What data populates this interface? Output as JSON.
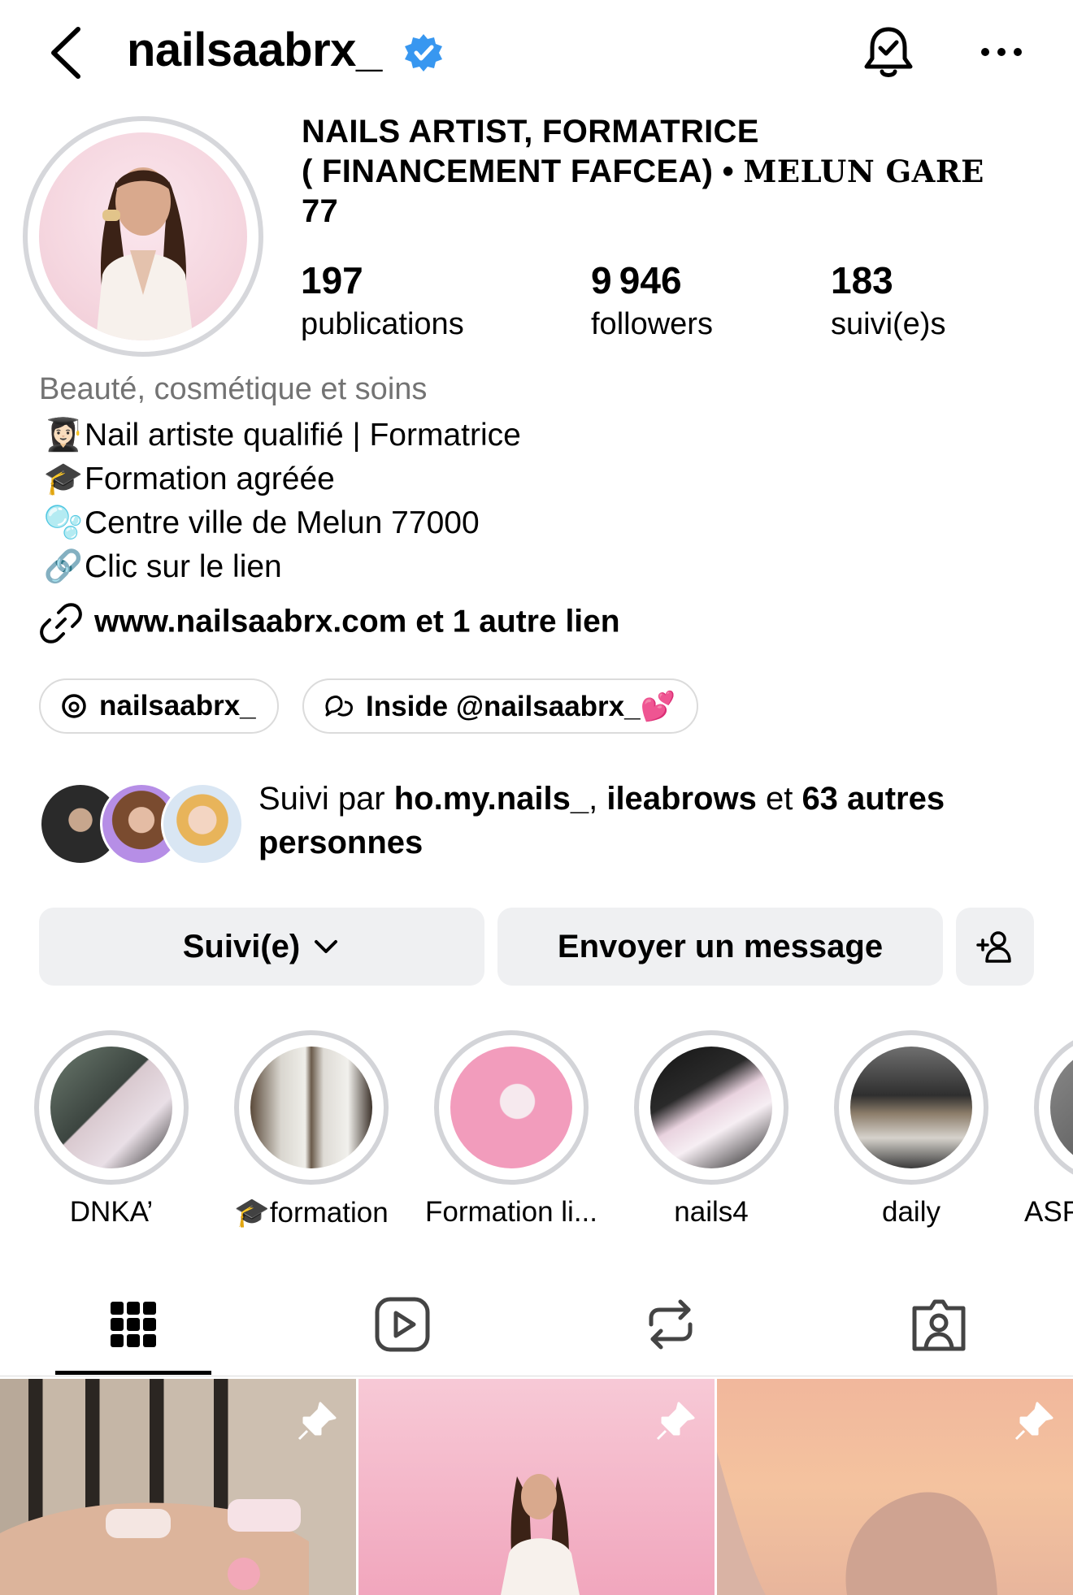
{
  "header": {
    "username": "nailsaabrx_",
    "icons": [
      "back-chevron-icon",
      "verified-badge-icon",
      "notification-bell-icon",
      "more-options-icon"
    ]
  },
  "profile": {
    "name_line1": "NAILS ARTIST, FORMATRICE",
    "name_line2": "( FINANCEMENT FAFCEA) • ",
    "name_line2_styled": "MELUN GARE",
    "name_line3": "77",
    "stats": {
      "posts_count": "197",
      "posts_label": "publications",
      "followers_count": "9 946",
      "followers_label": "followers",
      "following_count": "183",
      "following_label": "suivi(e)s"
    },
    "category": "Beauté, cosmétique et soins",
    "bio": [
      {
        "emoji": "👩🏻‍🎓",
        "text": "Nail artiste qualifié | Formatrice"
      },
      {
        "emoji": "🎓",
        "text": "Formation agréée"
      },
      {
        "emoji": "🫧",
        "text": "Centre ville de Melun 77000"
      },
      {
        "emoji": "🔗",
        "text": "Clic sur le lien"
      }
    ],
    "link_text": "www.nailsaabrx.com et 1 autre lien",
    "pills": [
      {
        "icon": "threads-icon",
        "label": "nailsaabrx_"
      },
      {
        "icon": "channel-icon",
        "label": "Inside @nailsaabrx_💕"
      }
    ],
    "mutual": {
      "prefix": "Suivi par ",
      "user1": "ho.my.nails_",
      "sep": ", ",
      "user2": "ileabrows",
      "mid": " et ",
      "others": "63 autres personnes"
    }
  },
  "actions": {
    "follow_label": "Suivi(e)",
    "message_label": "Envoyer un message"
  },
  "highlights": [
    {
      "label": "DNKA’"
    },
    {
      "label": "🎓formation"
    },
    {
      "label": "Formation li..."
    },
    {
      "label": "nails4"
    },
    {
      "label": "daily"
    },
    {
      "label": "ASP"
    }
  ],
  "tabs": [
    "grid-icon",
    "reels-icon",
    "reposts-icon",
    "tagged-icon"
  ],
  "posts": [
    {
      "pinned": true
    },
    {
      "pinned": true
    },
    {
      "pinned": true
    }
  ],
  "colors": {
    "verified": "#3897f0",
    "button_bg": "#eff0f2",
    "secondary_text": "#737373"
  }
}
